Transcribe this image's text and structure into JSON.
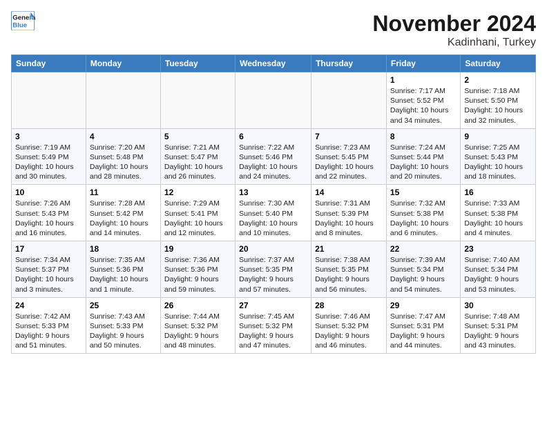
{
  "header": {
    "logo_line1": "General",
    "logo_line2": "Blue",
    "month_title": "November 2024",
    "location": "Kadinhani, Turkey"
  },
  "weekdays": [
    "Sunday",
    "Monday",
    "Tuesday",
    "Wednesday",
    "Thursday",
    "Friday",
    "Saturday"
  ],
  "weeks": [
    [
      {
        "day": "",
        "info": ""
      },
      {
        "day": "",
        "info": ""
      },
      {
        "day": "",
        "info": ""
      },
      {
        "day": "",
        "info": ""
      },
      {
        "day": "",
        "info": ""
      },
      {
        "day": "1",
        "info": "Sunrise: 7:17 AM\nSunset: 5:52 PM\nDaylight: 10 hours and 34 minutes."
      },
      {
        "day": "2",
        "info": "Sunrise: 7:18 AM\nSunset: 5:50 PM\nDaylight: 10 hours and 32 minutes."
      }
    ],
    [
      {
        "day": "3",
        "info": "Sunrise: 7:19 AM\nSunset: 5:49 PM\nDaylight: 10 hours and 30 minutes."
      },
      {
        "day": "4",
        "info": "Sunrise: 7:20 AM\nSunset: 5:48 PM\nDaylight: 10 hours and 28 minutes."
      },
      {
        "day": "5",
        "info": "Sunrise: 7:21 AM\nSunset: 5:47 PM\nDaylight: 10 hours and 26 minutes."
      },
      {
        "day": "6",
        "info": "Sunrise: 7:22 AM\nSunset: 5:46 PM\nDaylight: 10 hours and 24 minutes."
      },
      {
        "day": "7",
        "info": "Sunrise: 7:23 AM\nSunset: 5:45 PM\nDaylight: 10 hours and 22 minutes."
      },
      {
        "day": "8",
        "info": "Sunrise: 7:24 AM\nSunset: 5:44 PM\nDaylight: 10 hours and 20 minutes."
      },
      {
        "day": "9",
        "info": "Sunrise: 7:25 AM\nSunset: 5:43 PM\nDaylight: 10 hours and 18 minutes."
      }
    ],
    [
      {
        "day": "10",
        "info": "Sunrise: 7:26 AM\nSunset: 5:43 PM\nDaylight: 10 hours and 16 minutes."
      },
      {
        "day": "11",
        "info": "Sunrise: 7:28 AM\nSunset: 5:42 PM\nDaylight: 10 hours and 14 minutes."
      },
      {
        "day": "12",
        "info": "Sunrise: 7:29 AM\nSunset: 5:41 PM\nDaylight: 10 hours and 12 minutes."
      },
      {
        "day": "13",
        "info": "Sunrise: 7:30 AM\nSunset: 5:40 PM\nDaylight: 10 hours and 10 minutes."
      },
      {
        "day": "14",
        "info": "Sunrise: 7:31 AM\nSunset: 5:39 PM\nDaylight: 10 hours and 8 minutes."
      },
      {
        "day": "15",
        "info": "Sunrise: 7:32 AM\nSunset: 5:38 PM\nDaylight: 10 hours and 6 minutes."
      },
      {
        "day": "16",
        "info": "Sunrise: 7:33 AM\nSunset: 5:38 PM\nDaylight: 10 hours and 4 minutes."
      }
    ],
    [
      {
        "day": "17",
        "info": "Sunrise: 7:34 AM\nSunset: 5:37 PM\nDaylight: 10 hours and 3 minutes."
      },
      {
        "day": "18",
        "info": "Sunrise: 7:35 AM\nSunset: 5:36 PM\nDaylight: 10 hours and 1 minute."
      },
      {
        "day": "19",
        "info": "Sunrise: 7:36 AM\nSunset: 5:36 PM\nDaylight: 9 hours and 59 minutes."
      },
      {
        "day": "20",
        "info": "Sunrise: 7:37 AM\nSunset: 5:35 PM\nDaylight: 9 hours and 57 minutes."
      },
      {
        "day": "21",
        "info": "Sunrise: 7:38 AM\nSunset: 5:35 PM\nDaylight: 9 hours and 56 minutes."
      },
      {
        "day": "22",
        "info": "Sunrise: 7:39 AM\nSunset: 5:34 PM\nDaylight: 9 hours and 54 minutes."
      },
      {
        "day": "23",
        "info": "Sunrise: 7:40 AM\nSunset: 5:34 PM\nDaylight: 9 hours and 53 minutes."
      }
    ],
    [
      {
        "day": "24",
        "info": "Sunrise: 7:42 AM\nSunset: 5:33 PM\nDaylight: 9 hours and 51 minutes."
      },
      {
        "day": "25",
        "info": "Sunrise: 7:43 AM\nSunset: 5:33 PM\nDaylight: 9 hours and 50 minutes."
      },
      {
        "day": "26",
        "info": "Sunrise: 7:44 AM\nSunset: 5:32 PM\nDaylight: 9 hours and 48 minutes."
      },
      {
        "day": "27",
        "info": "Sunrise: 7:45 AM\nSunset: 5:32 PM\nDaylight: 9 hours and 47 minutes."
      },
      {
        "day": "28",
        "info": "Sunrise: 7:46 AM\nSunset: 5:32 PM\nDaylight: 9 hours and 46 minutes."
      },
      {
        "day": "29",
        "info": "Sunrise: 7:47 AM\nSunset: 5:31 PM\nDaylight: 9 hours and 44 minutes."
      },
      {
        "day": "30",
        "info": "Sunrise: 7:48 AM\nSunset: 5:31 PM\nDaylight: 9 hours and 43 minutes."
      }
    ]
  ]
}
